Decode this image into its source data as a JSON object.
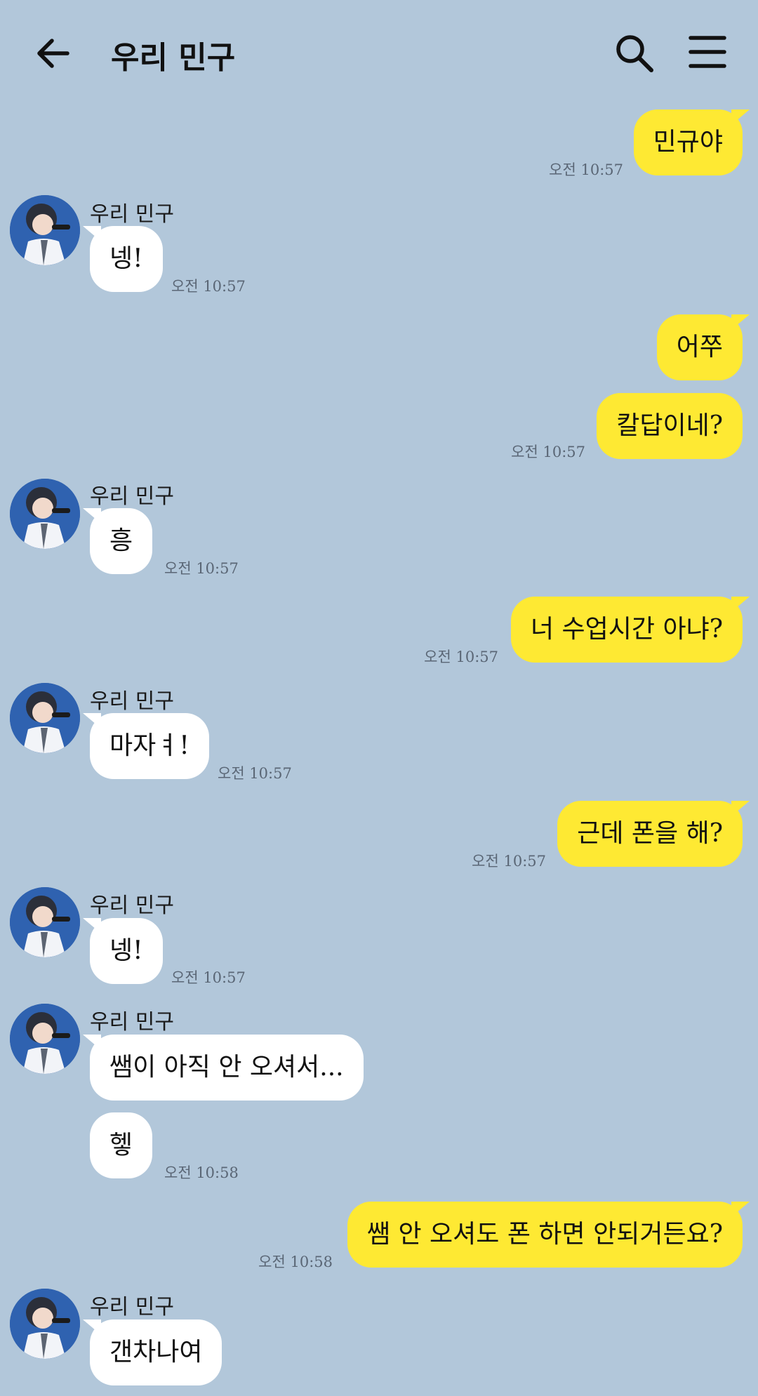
{
  "header": {
    "title": "우리 민구",
    "back_icon": "arrow-left-icon",
    "search_icon": "search-icon",
    "menu_icon": "hamburger-menu-icon"
  },
  "colors": {
    "background": "#b2c7da",
    "outgoing_bubble": "#fee933",
    "incoming_bubble": "#ffffff"
  },
  "messages": [
    {
      "dir": "out",
      "text": "민규야",
      "time": "오전 10:57"
    },
    {
      "dir": "in",
      "sender": "우리 민구",
      "text": "넹!",
      "time": "오전 10:57"
    },
    {
      "dir": "out",
      "text": "어쭈",
      "time": ""
    },
    {
      "dir": "out",
      "text": "칼답이네?",
      "time": "오전 10:57"
    },
    {
      "dir": "in",
      "sender": "우리 민구",
      "text": "흥",
      "time": "오전 10:57"
    },
    {
      "dir": "out",
      "text": "너 수업시간 아냐?",
      "time": "오전 10:57"
    },
    {
      "dir": "in",
      "sender": "우리 민구",
      "text": "마자ㅕ!",
      "time": "오전 10:57"
    },
    {
      "dir": "out",
      "text": "근데 폰을 해?",
      "time": "오전 10:57"
    },
    {
      "dir": "in",
      "sender": "우리 민구",
      "text": "넹!",
      "time": "오전 10:57"
    },
    {
      "dir": "in",
      "sender": "우리 민구",
      "text": "쌤이 아직 안 오셔서...",
      "time": ""
    },
    {
      "dir": "in",
      "text": "헿",
      "time": "오전 10:58"
    },
    {
      "dir": "out",
      "text": "쌤 안 오셔도 폰 하면 안되거든요?",
      "time": "오전 10:58"
    },
    {
      "dir": "in",
      "sender": "우리 민구",
      "text": "갠차나여",
      "time": ""
    }
  ]
}
